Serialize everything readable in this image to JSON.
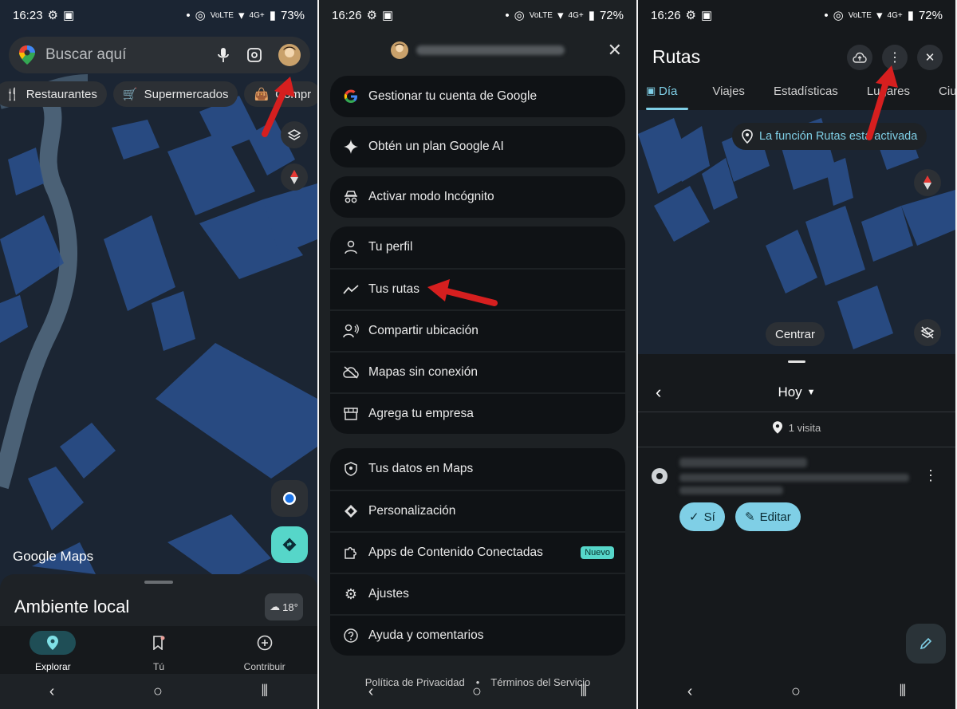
{
  "panel1": {
    "status": {
      "time": "16:23",
      "battery": "73%",
      "net_small": "Vo⁩LTE",
      "signal": "4G+"
    },
    "search": {
      "placeholder": "Buscar aquí"
    },
    "chips": [
      {
        "label": "Restaurantes",
        "icon": "fork-knife-icon"
      },
      {
        "label": "Supermercados",
        "icon": "cart-icon"
      },
      {
        "label": "Compr",
        "icon": "bag-icon"
      }
    ],
    "brand": "Google Maps",
    "sheet": {
      "title": "Ambiente local",
      "weather": "18°"
    },
    "bottom_nav": [
      {
        "label": "Explorar",
        "icon": "location-pin-icon",
        "active": true
      },
      {
        "label": "Tú",
        "icon": "bookmark-icon",
        "active": false
      },
      {
        "label": "Contribuir",
        "icon": "plus-circle-icon",
        "active": false
      }
    ]
  },
  "panel2": {
    "status": {
      "time": "16:26",
      "battery": "72%",
      "signal": "4G+"
    },
    "groups": [
      [
        {
          "label": "Gestionar tu cuenta de Google",
          "icon": "google-g-icon"
        }
      ],
      [
        {
          "label": "Obtén un plan Google AI",
          "icon": "sparkle-icon"
        }
      ],
      [
        {
          "label": "Activar modo Incógnito",
          "icon": "incognito-icon"
        }
      ],
      [
        {
          "label": "Tu perfil",
          "icon": "person-icon"
        },
        {
          "label": "Tus rutas",
          "icon": "trending-icon"
        },
        {
          "label": "Compartir ubicación",
          "icon": "share-location-icon"
        },
        {
          "label": "Mapas sin conexión",
          "icon": "cloud-off-icon"
        },
        {
          "label": "Agrega tu empresa",
          "icon": "store-icon"
        }
      ],
      [
        {
          "label": "Tus datos en Maps",
          "icon": "shield-icon"
        },
        {
          "label": "Personalización",
          "icon": "diamond-icon"
        },
        {
          "label": "Apps de Contenido Conectadas",
          "icon": "puzzle-icon",
          "badge": "Nuevo"
        },
        {
          "label": "Ajustes",
          "icon": "gear-icon"
        },
        {
          "label": "Ayuda y comentarios",
          "icon": "help-icon"
        }
      ]
    ],
    "footer": {
      "privacy": "Política de Privacidad",
      "terms": "Términos del Servicio"
    }
  },
  "panel3": {
    "status": {
      "time": "16:26",
      "battery": "72%",
      "signal": "4G+"
    },
    "title": "Rutas",
    "tabs": [
      "Día",
      "Viajes",
      "Estadísticas",
      "Lugares",
      "Ciu"
    ],
    "banner": "La función Rutas está activada",
    "center_button": "Centrar",
    "day_label": "Hoy",
    "visits": "1 visita",
    "actions": {
      "yes": "Sí",
      "edit": "Editar"
    }
  },
  "colors": {
    "accent": "#7fcfe6",
    "arrow": "#d61f1f",
    "map_block": "#2a4f8a",
    "badge": "#56d6c9"
  }
}
